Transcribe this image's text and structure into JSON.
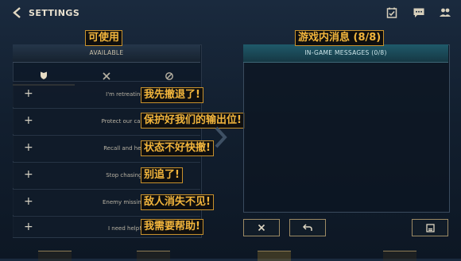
{
  "header": {
    "title": "SETTINGS"
  },
  "left_panel": {
    "caption": "可使用",
    "header": "AVAILABLE",
    "rows": [
      {
        "text": "I'm retreating",
        "caption": "我先撤退了!"
      },
      {
        "text": "Protect our carry",
        "caption": "保护好我们的输出位!"
      },
      {
        "text": "Recall and heal",
        "caption": "状态不好快撤!"
      },
      {
        "text": "Stop chasing.",
        "caption": "别追了!"
      },
      {
        "text": "Enemy missing!",
        "caption": "敌人消失不见!"
      },
      {
        "text": "I need help!",
        "caption": "我需要帮助!"
      }
    ],
    "plus_glyph": "+"
  },
  "right_panel": {
    "caption": "游戏内消息 (8/8)",
    "header": "IN-GAME MESSAGES (0/8)"
  },
  "colors": {
    "caption_text": "#f2b53c",
    "gold": "#c8aa6e",
    "teal_header": "#1f5a6a"
  },
  "icons": [
    "back-icon",
    "calendar-check-icon",
    "chat-icon",
    "friends-icon",
    "shield-icon",
    "crossed-swords-icon",
    "ping-icon",
    "chevron-right-icon",
    "close-icon",
    "undo-icon",
    "save-icon"
  ]
}
